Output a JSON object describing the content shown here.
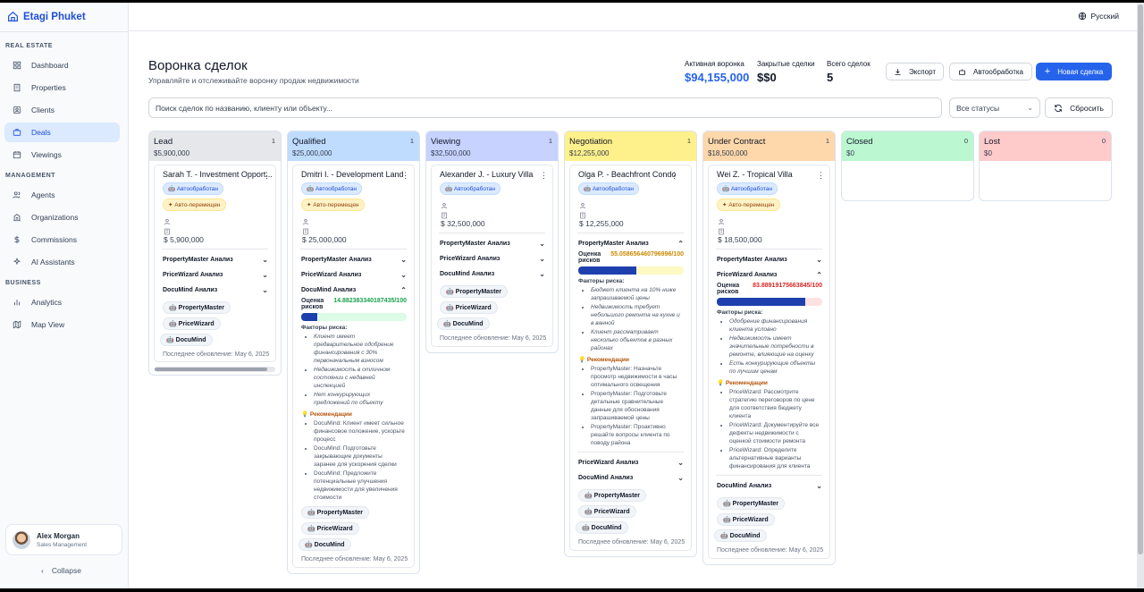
{
  "app": {
    "name": "Etagi Phuket"
  },
  "language": {
    "label": "Русский"
  },
  "sidebar": {
    "sections": [
      {
        "title": "REAL ESTATE",
        "items": [
          {
            "label": "Dashboard",
            "icon": "dashboard-icon"
          },
          {
            "label": "Properties",
            "icon": "building-icon"
          },
          {
            "label": "Clients",
            "icon": "contacts-icon"
          },
          {
            "label": "Deals",
            "icon": "briefcase-icon",
            "active": true
          },
          {
            "label": "Viewings",
            "icon": "calendar-icon"
          }
        ]
      },
      {
        "title": "MANAGEMENT",
        "items": [
          {
            "label": "Agents",
            "icon": "users-icon"
          },
          {
            "label": "Organizations",
            "icon": "organization-icon"
          },
          {
            "label": "Commissions",
            "icon": "dollar-icon"
          },
          {
            "label": "AI Assistants",
            "icon": "sparkles-icon"
          }
        ]
      },
      {
        "title": "BUSINESS",
        "items": [
          {
            "label": "Analytics",
            "icon": "bar-chart-icon"
          },
          {
            "label": "Map View",
            "icon": "map-icon"
          }
        ]
      }
    ],
    "user": {
      "name": "Alex Morgan",
      "role": "Sales Management"
    },
    "collapse_label": "Collapse"
  },
  "header": {
    "title": "Воронка сделок",
    "subtitle": "Управляйте и отслеживайте воронку продаж недвижимости",
    "stats": {
      "active_label": "Активная воронка",
      "active_value": "$94,155,000",
      "closed_label": "Закрытые сделки",
      "closed_value": "$$0",
      "total_label": "Всего сделок",
      "total_value": "5"
    },
    "export_label": "Экспорт",
    "autoprocess_label": "Автообработка",
    "new_deal_label": "Новая сделка"
  },
  "filters": {
    "search_placeholder": "Поиск сделок по названию, клиенту или объекту...",
    "status_value": "Все статусы",
    "reset_label": "Сбросить"
  },
  "common": {
    "tag_auto": "Автообработан",
    "tag_moved": "Авто-перемещен",
    "score_label": "Оценка рисков",
    "risk_factors_label": "Факторы риска:",
    "recommendations_label": "Рекомендации",
    "updated": "Последнее обновление: May 6, 2025",
    "analyses": [
      "PropertyMaster Анализ",
      "PriceWizard Анализ",
      "DocuMind Анализ"
    ],
    "agents": [
      "PropertyMaster",
      "PriceWizard",
      "DocuMind"
    ]
  },
  "columns": [
    {
      "title": "Lead",
      "amount": "$5,900,000",
      "count": "1",
      "color": "#e5e7eb"
    },
    {
      "title": "Qualified",
      "amount": "$25,000,000",
      "count": "1",
      "color": "#bfdbfe"
    },
    {
      "title": "Viewing",
      "amount": "$32,500,000",
      "count": "1",
      "color": "#c7d2fe"
    },
    {
      "title": "Negotiation",
      "amount": "$12,255,000",
      "count": "1",
      "color": "#fef08a"
    },
    {
      "title": "Under Contract",
      "amount": "$18,500,000",
      "count": "1",
      "color": "#fed7aa"
    },
    {
      "title": "Closed",
      "amount": "$0",
      "count": "0",
      "color": "#bbf7d0"
    },
    {
      "title": "Lost",
      "amount": "$0",
      "count": "0",
      "color": "#fecaca"
    }
  ],
  "deals": {
    "lead": {
      "title": "Sarah T. - Investment Opport...",
      "price": "$ 5,900,000"
    },
    "qualified": {
      "title": "Dmitri I. - Development Land",
      "price": "$ 25,000,000",
      "score": "14.882383340187435/100",
      "score_fraction": 0.149,
      "score_color": "#16a34a",
      "risks": [
        "Клиент имеет предварительное одобрение финансирования с 30% первоначальным взносом",
        "Недвижимость в отличном состоянии с недавней инспекцией",
        "Нет конкурирующих предложений по объекту"
      ],
      "recs": [
        "DocuMind: Клиент имеет сильное финансовое положение, ускорьте процесс",
        "DocuMind: Подготовьте закрывающие документы заранее для ускорения сделки",
        "DocuMind: Предложите потенциальные улучшения недвижимости для увеличения стоимости"
      ]
    },
    "viewing": {
      "title": "Alexander J. - Luxury Villa",
      "price": "$ 32,500,000"
    },
    "negotiation": {
      "title": "Olga P. - Beachfront Condo",
      "price": "$ 12,255,000",
      "score": "55.058656460796996/100",
      "score_fraction": 0.551,
      "score_color": "#ca8a04",
      "risks": [
        "Бюджет клиента на 10% ниже запрашиваемой цены",
        "Недвижимость требует небольшого ремонта на кухне и в ванной",
        "Клиент рассматривает несколько объектов в разных районах"
      ],
      "recs": [
        "PropertyMaster: Назначьте просмотр недвижимости в часы оптимального освещения",
        "PropertyMaster: Подготовьте детальные сравнительные данные для обоснования запрашиваемой цены",
        "PropertyMaster: Проактивно решайте вопросы клиента по поводу района"
      ]
    },
    "contract": {
      "title": "Wei Z. - Tropical Villa",
      "price": "$ 18,500,000",
      "score": "83.88919175663845/100",
      "score_fraction": 0.839,
      "score_color": "#dc2626",
      "risks": [
        "Одобрение финансирования клиента условно",
        "Недвижимость имеет значительные потребности в ремонте, влияющие на оценку",
        "Есть конкурирующие объекты по лучшим ценам"
      ],
      "recs": [
        "PriceWizard: Рассмотрите стратегию переговоров по цене для соответствия бюджету клиента",
        "PriceWizard: Документируйте все дефекты недвижимости с оценкой стоимости ремонта",
        "PriceWizard: Определите альтернативные варианты финансирования для клиента"
      ]
    }
  }
}
